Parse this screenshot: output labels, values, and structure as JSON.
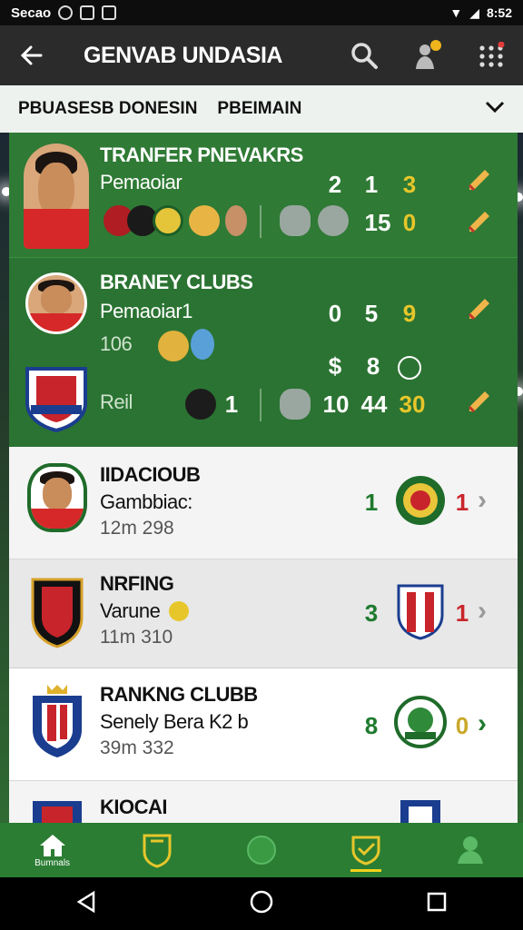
{
  "status": {
    "left_text": "Secao",
    "right_text": "8:52"
  },
  "app": {
    "title": "GENVAB UNDASIA"
  },
  "filters": {
    "tab1": "PBUASESB DONESIN",
    "tab2": "PBEIMAIN"
  },
  "cards": [
    {
      "title": "TRANFER PNEVAKRS",
      "subtitle": "Pemaoiar",
      "top_nums": [
        "2",
        "1",
        "3"
      ],
      "bottom_nums": [
        "15",
        "0"
      ]
    },
    {
      "title": "BRANEY CLUBS",
      "subtitle": "Pemaoiar1",
      "extra": "106",
      "top_nums": [
        "0",
        "5",
        "9"
      ],
      "row3_label": "Reil",
      "row3_nums": [
        "1",
        "10",
        "44",
        "30"
      ],
      "row3_icons": [
        "$",
        "8"
      ]
    },
    {
      "title": "IIDACIOUB",
      "subtitle": "Gambbiac:",
      "meta": "12m 298",
      "left_num": "1",
      "right_num": "1"
    },
    {
      "title": "NRFING",
      "subtitle": "Varune",
      "meta": "11m 310",
      "left_num": "3",
      "right_num": "1"
    },
    {
      "title": "RANKNG CLUBB",
      "subtitle": "Senely Bera K2 b",
      "meta": "39m 332",
      "left_num": "8",
      "right_num": "0"
    },
    {
      "title": "KIOCAI"
    }
  ],
  "nav": {
    "home_label": "Bumnals"
  },
  "colors": {
    "primary_green": "#2f7a35",
    "accent_yellow": "#e7c62b",
    "accent_red": "#c9252c"
  }
}
